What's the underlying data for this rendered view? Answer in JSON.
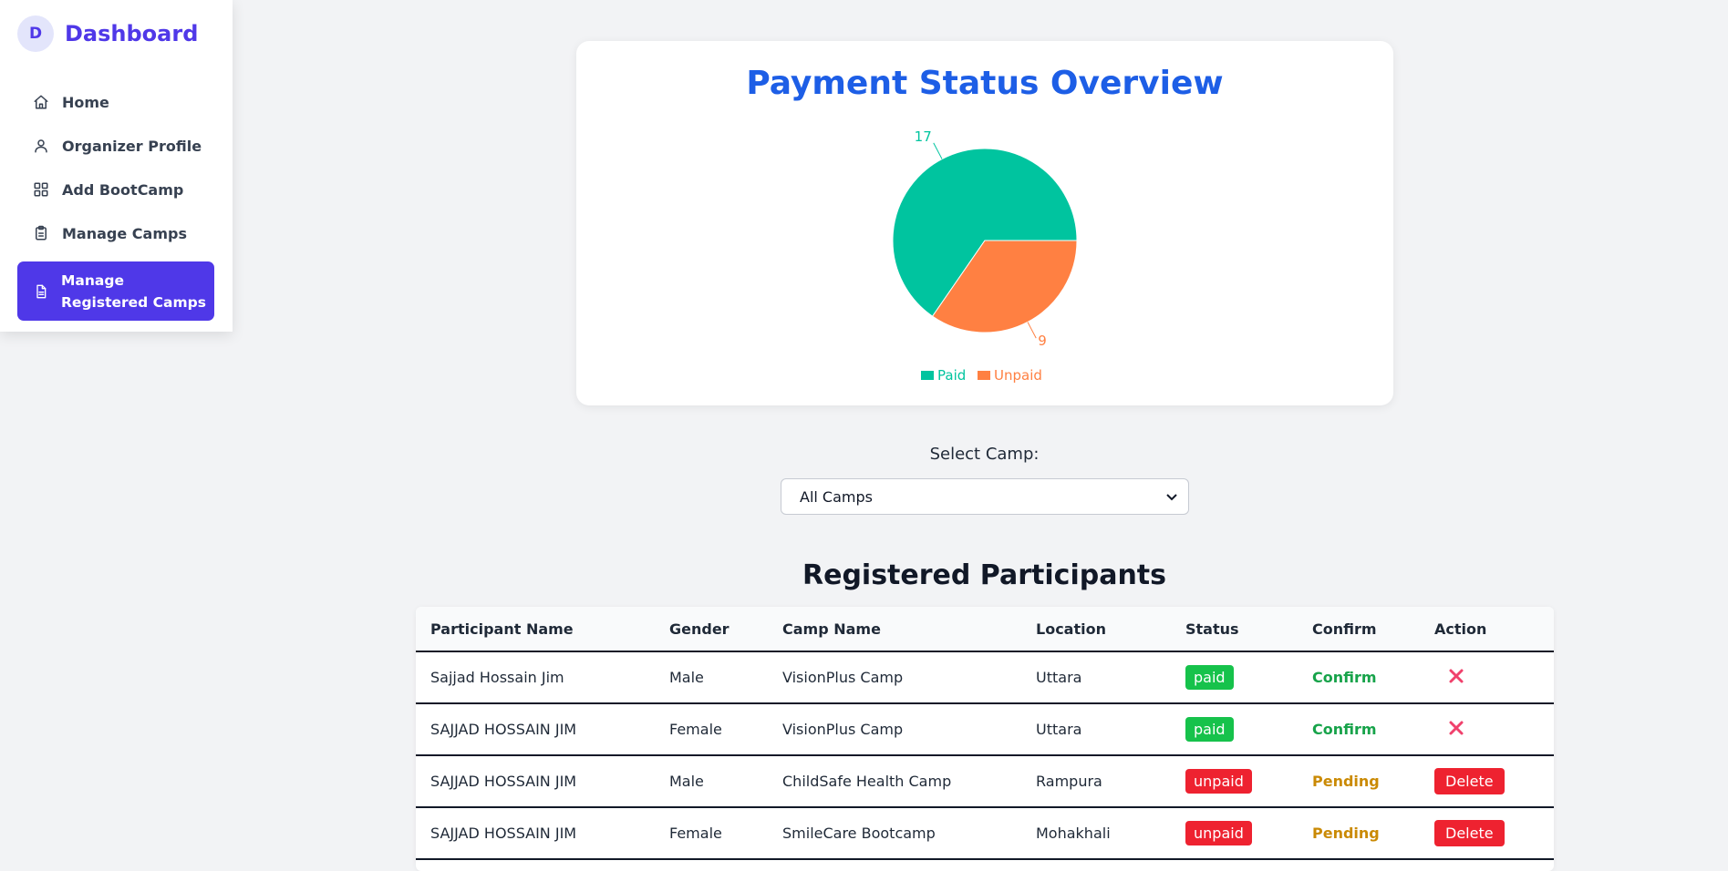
{
  "sidebar": {
    "avatar_letter": "D",
    "title": "Dashboard",
    "items": [
      {
        "label": "Home",
        "icon": "home-icon"
      },
      {
        "label": "Organizer Profile",
        "icon": "user-icon"
      },
      {
        "label": "Add BootCamp",
        "icon": "grid-icon"
      },
      {
        "label": "Manage Camps",
        "icon": "clipboard-icon"
      },
      {
        "label": "Manage Registered Camps",
        "icon": "document-icon",
        "active": true
      }
    ]
  },
  "chart": {
    "title": "Payment Status Overview"
  },
  "chart_data": {
    "type": "pie",
    "title": "Payment Status Overview",
    "slices": [
      {
        "label": "Paid",
        "value": 17,
        "color": "#00c49f"
      },
      {
        "label": "Unpaid",
        "value": 9,
        "color": "#ff8042"
      }
    ],
    "legend_position": "bottom"
  },
  "filter": {
    "label": "Select Camp:",
    "selected": "All Camps"
  },
  "table": {
    "title": "Registered Participants",
    "headers": [
      "Participant Name",
      "Gender",
      "Camp Name",
      "Location",
      "Status",
      "Confirm",
      "Action"
    ],
    "rows": [
      {
        "name": "Sajjad Hossain Jim",
        "gender": "Male",
        "camp": "VisionPlus Camp",
        "location": "Uttara",
        "status": "paid",
        "confirm": "Confirm",
        "action": "cancel-icon"
      },
      {
        "name": "SAJJAD HOSSAIN JIM",
        "gender": "Female",
        "camp": "VisionPlus Camp",
        "location": "Uttara",
        "status": "paid",
        "confirm": "Confirm",
        "action": "cancel-icon"
      },
      {
        "name": "SAJJAD HOSSAIN JIM",
        "gender": "Male",
        "camp": "ChildSafe Health Camp",
        "location": "Rampura",
        "status": "unpaid",
        "confirm": "Pending",
        "action": "Delete"
      },
      {
        "name": "SAJJAD HOSSAIN JIM",
        "gender": "Female",
        "camp": "SmileCare Bootcamp",
        "location": "Mohakhali",
        "status": "unpaid",
        "confirm": "Pending",
        "action": "Delete"
      }
    ]
  }
}
